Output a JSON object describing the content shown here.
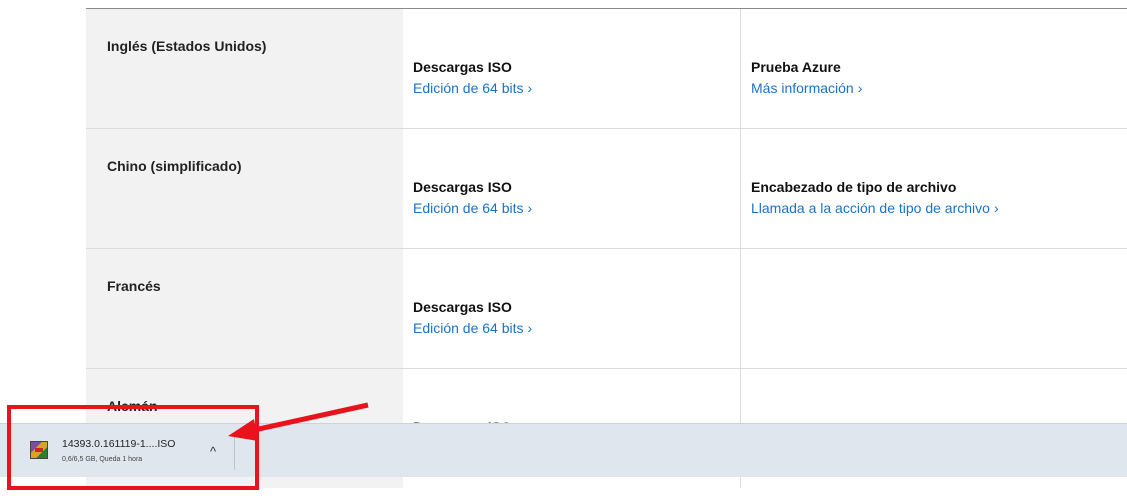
{
  "rows": [
    {
      "language": "Inglés (Estados Unidos)",
      "col1": {
        "title": "Descargas ISO",
        "link": "Edición de 64 bits"
      },
      "col2": {
        "title": "Prueba Azure",
        "link": "Más información"
      }
    },
    {
      "language": "Chino (simplificado)",
      "col1": {
        "title": "Descargas ISO",
        "link": "Edición de 64 bits"
      },
      "col2": {
        "title": "Encabezado de tipo de archivo",
        "link": "Llamada a la acción de tipo de archivo"
      }
    },
    {
      "language": "Francés",
      "col1": {
        "title": "Descargas ISO",
        "link": "Edición de 64 bits"
      }
    },
    {
      "language": "Alemán",
      "col1": {
        "title": "Descargas ISO"
      }
    }
  ],
  "chevron_glyph": "›",
  "download_bar": {
    "filename": "14393.0.161119-1....ISO",
    "status": "0,6/6,5 GB, Queda 1 hora",
    "expand_glyph": "^",
    "icon": "archive-file-icon"
  },
  "colors": {
    "link": "#1a73c8",
    "annotation": "#e8131c",
    "download_bar_bg": "#dfe6ee"
  }
}
